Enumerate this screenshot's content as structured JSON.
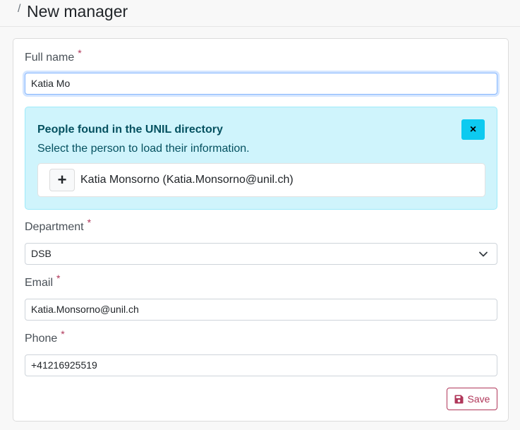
{
  "header": {
    "breadcrumb_separator": "/",
    "title": "New manager"
  },
  "form": {
    "full_name": {
      "label": "Full name",
      "required_mark": "*",
      "value": "Katia Mo"
    },
    "directory_alert": {
      "title": "People found in the UNIL directory",
      "subtitle": "Select the person to load their information.",
      "close_glyph": "×",
      "results": [
        {
          "add_glyph": "+",
          "text": "Katia Monsorno (Katia.Monsorno@unil.ch)"
        }
      ]
    },
    "department": {
      "label": "Department",
      "required_mark": "*",
      "value": "DSB"
    },
    "email": {
      "label": "Email",
      "required_mark": "*",
      "value": "Katia.Monsorno@unil.ch"
    },
    "phone": {
      "label": "Phone",
      "required_mark": "*",
      "value": "+41216925519"
    },
    "save_label": "Save"
  },
  "colors": {
    "accent": "#b0375a",
    "alert_bg": "#cff4fc",
    "alert_text": "#055160",
    "close_button": "#0dcaf0"
  }
}
